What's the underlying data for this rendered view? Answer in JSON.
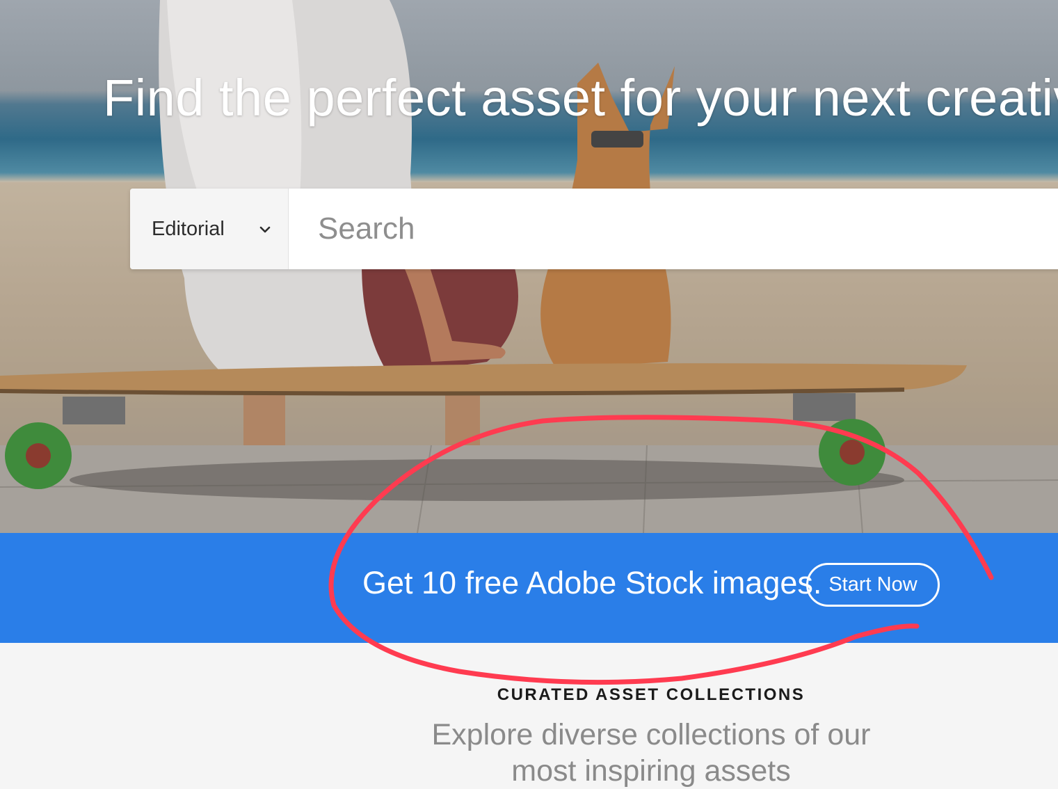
{
  "hero": {
    "title": "Find the perfect asset for your next creative p"
  },
  "search": {
    "filter_selected": "Editorial",
    "placeholder": "Search"
  },
  "promo": {
    "text": "Get 10 free Adobe Stock images.",
    "button_label": "Start Now"
  },
  "collections": {
    "eyebrow": "CURATED ASSET COLLECTIONS",
    "subtitle_line1": "Explore diverse collections of our",
    "subtitle_line2": "most inspiring assets"
  },
  "colors": {
    "promo_blue": "#2a7ee8",
    "annotation_red": "#ff3b50"
  }
}
